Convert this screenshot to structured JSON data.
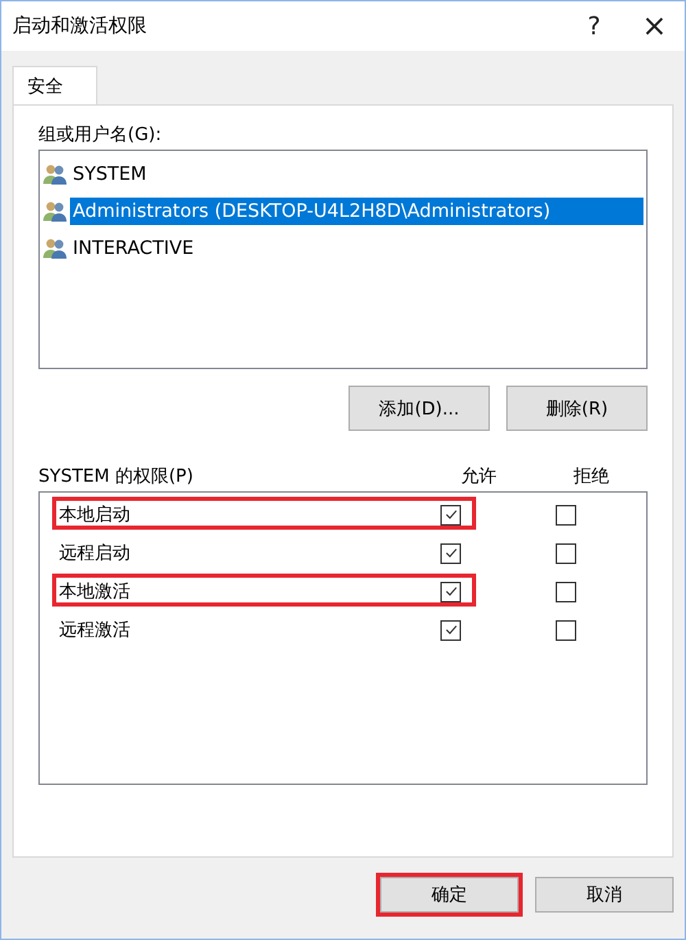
{
  "window": {
    "title": "启动和激活权限",
    "help": "?",
    "close": "×"
  },
  "tabs": [
    {
      "label": "安全",
      "selected": true
    }
  ],
  "group_label": "组或用户名(G):",
  "users": [
    {
      "name": "SYSTEM",
      "selected": false
    },
    {
      "name": "Administrators (DESKTOP-U4L2H8D\\Administrators)",
      "selected": true
    },
    {
      "name": "INTERACTIVE",
      "selected": false
    }
  ],
  "user_buttons": [
    "添加(D)...",
    "删除(R)"
  ],
  "permissions": {
    "title": "SYSTEM 的权限(P)",
    "columns": [
      "允许",
      "拒绝"
    ],
    "rows": [
      {
        "name": "本地启动",
        "allow": true,
        "deny": false,
        "highlighted": true
      },
      {
        "name": "远程启动",
        "allow": true,
        "deny": false,
        "highlighted": false
      },
      {
        "name": "本地激活",
        "allow": true,
        "deny": false,
        "highlighted": true
      },
      {
        "name": "远程激活",
        "allow": true,
        "deny": false,
        "highlighted": false
      }
    ]
  },
  "buttons": [
    {
      "label": "确定",
      "highlighted": true
    },
    {
      "label": "取消",
      "highlighted": false
    }
  ]
}
